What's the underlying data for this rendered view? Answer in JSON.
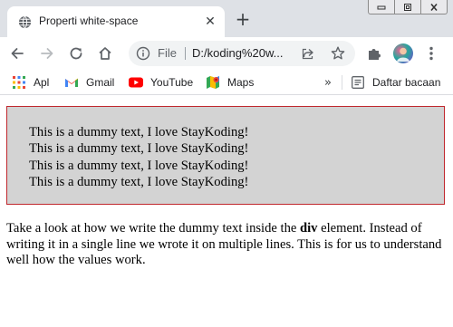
{
  "browser": {
    "tab": {
      "title": "Properti white-space",
      "close_glyph": "✕",
      "favicon": "globe-icon"
    },
    "new_tab_glyph": "+",
    "window_controls": [
      "minimize-icon",
      "restore-icon",
      "close-icon"
    ],
    "omnibox": {
      "scheme": "File",
      "url": "D:/koding%20w..."
    },
    "bookmarks": [
      {
        "label": "Apl",
        "icon": "apps-grid-icon"
      },
      {
        "label": "Gmail",
        "icon": "gmail-icon"
      },
      {
        "label": "YouTube",
        "icon": "youtube-icon"
      },
      {
        "label": "Maps",
        "icon": "maps-icon"
      }
    ],
    "bookmarks_overflow": "»",
    "reading_list": {
      "label": "Daftar bacaan",
      "icon": "reading-list-icon"
    }
  },
  "page": {
    "demo_lines": [
      "This is a dummy text, I love StayKoding!",
      "This is a dummy text, I love StayKoding!",
      "This is a dummy text, I love StayKoding!",
      "This is a dummy text, I love StayKoding!"
    ],
    "paragraph": {
      "before": "Take a look at how we write the dummy text inside the ",
      "bold": "div",
      "after": " element. Instead of writing it in a single line we wrote it on multiple lines. This is for us to understand well how the values work."
    }
  },
  "colors": {
    "tabstrip_bg": "#dee1e6",
    "demo_bg": "#d3d3d3",
    "demo_border": "#c0272d"
  }
}
